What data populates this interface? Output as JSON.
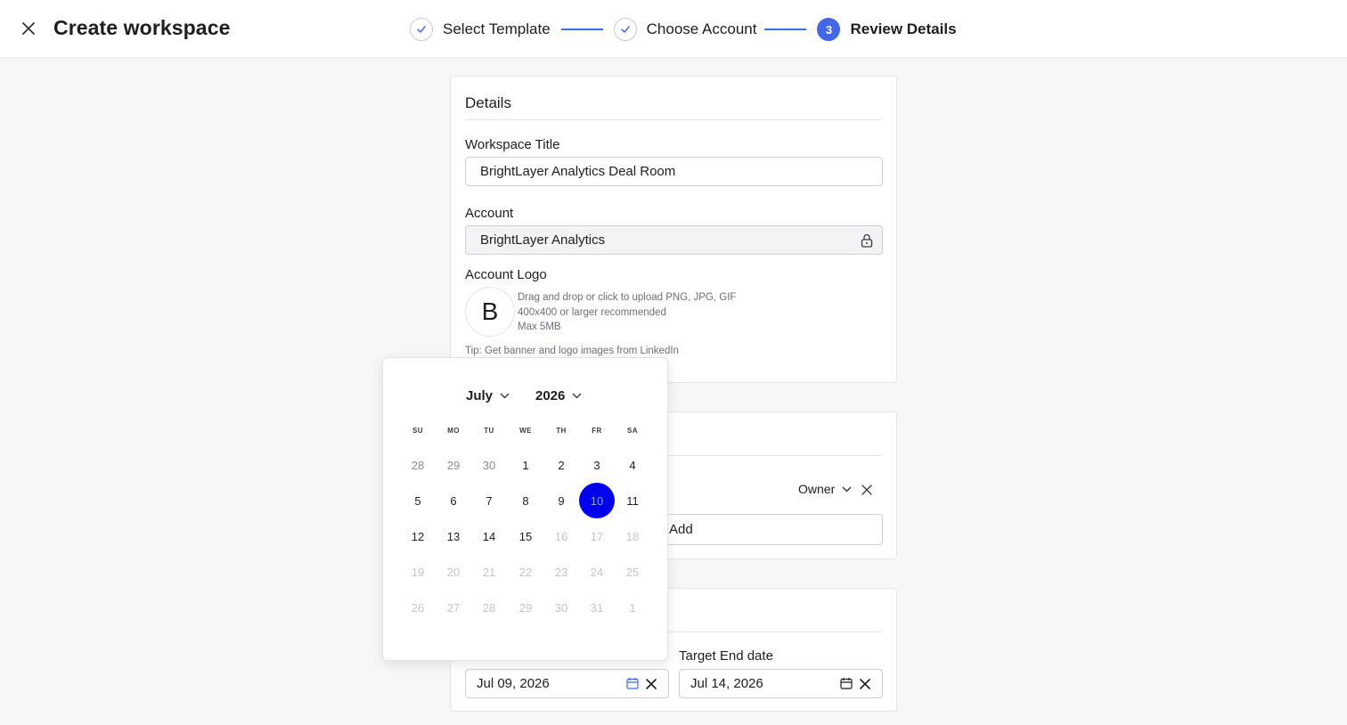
{
  "header": {
    "title": "Create workspace",
    "steps": [
      {
        "label": "Select Template",
        "state": "done"
      },
      {
        "label": "Choose Account",
        "state": "done"
      },
      {
        "label": "Review Details",
        "state": "active",
        "number": "3"
      }
    ]
  },
  "details": {
    "title": "Details",
    "workspace_title_label": "Workspace Title",
    "workspace_title_value": "BrightLayer Analytics Deal Room",
    "account_label": "Account",
    "account_value": "BrightLayer Analytics",
    "logo_label": "Account Logo",
    "logo_letter": "B",
    "logo_hint_1": "Drag and drop or click to upload PNG, JPG, GIF",
    "logo_hint_2": "400x400 or larger recommended",
    "logo_hint_3": "Max 5MB",
    "logo_tip": "Tip: Get banner and logo images from LinkedIn"
  },
  "members": {
    "role_value": "Owner",
    "add_text": "Add"
  },
  "dates": {
    "start_value": "Jul 09, 2026",
    "target_end_label": "Target End date",
    "target_end_value": "Jul 14, 2026"
  },
  "calendar": {
    "month": "July",
    "year": "2026",
    "weekdays": [
      "SU",
      "MO",
      "TU",
      "WE",
      "TH",
      "FR",
      "SA"
    ],
    "days": [
      "28",
      "29",
      "30",
      "1",
      "2",
      "3",
      "4",
      "5",
      "6",
      "7",
      "8",
      "9",
      "10",
      "11",
      "12",
      "13",
      "14",
      "15",
      "16",
      "17",
      "18",
      "19",
      "20",
      "21",
      "22",
      "23",
      "24",
      "25",
      "26",
      "27",
      "28",
      "29",
      "30",
      "31",
      "1"
    ],
    "selected": "10"
  },
  "colors": {
    "accent": "#4467e6",
    "selected_day": "#0000ee"
  },
  "icons": [
    "close-icon",
    "check-icon",
    "lock-icon",
    "chevron-down-icon",
    "calendar-icon"
  ]
}
